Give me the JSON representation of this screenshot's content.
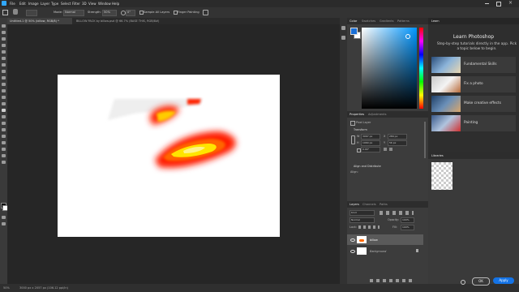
{
  "menu": [
    "File",
    "Edit",
    "Image",
    "Layer",
    "Type",
    "Select",
    "Filter",
    "3D",
    "View",
    "Window",
    "Help"
  ],
  "options": {
    "mode_label": "Mode:",
    "mode_value": "Normal",
    "strength_label": "Strength:",
    "strength_value": "50%",
    "angle_value": "0°",
    "sample_all": "Sample All Layers",
    "finger": "Finger Painting"
  },
  "tabs": [
    "Untitled-1 @ 50% (billow, RGB/8) *",
    "BILLOW PACK by billow.psd @ 66.7% (BASE THIS, RGB/8#)"
  ],
  "status": {
    "zoom": "50%",
    "doc": "3000 px x 2057 px (106.12 ppi/in)"
  },
  "color_panel": {
    "tabs": [
      "Color",
      "Swatches",
      "Gradients",
      "Patterns"
    ],
    "fg": "#1a6fd6",
    "bg": "#ffffff",
    "hue": "#0096ff"
  },
  "properties": {
    "tabs": [
      "Properties",
      "Adjustments"
    ],
    "layer_type": "Pixel Layer",
    "transform_title": "Transform",
    "w": "3067 px",
    "h": "1960 px",
    "x": "289 px",
    "y": "56 px",
    "angle": "0.00°",
    "align_title": "Align and Distribute",
    "align_label": "Align:"
  },
  "layers": {
    "tabs": [
      "Layers",
      "Channels",
      "Paths"
    ],
    "kind": "Kind",
    "blend": "Normal",
    "opacity_label": "Opacity:",
    "opacity_value": "100%",
    "lock_label": "Lock:",
    "fill_label": "Fill:",
    "fill_value": "100%",
    "items": [
      {
        "name": "billow",
        "selected": true
      },
      {
        "name": "Background",
        "selected": false
      }
    ]
  },
  "learn": {
    "tab": "Learn",
    "title": "Learn Photoshop",
    "subtitle": "Step-by-step tutorials directly in the app. Pick a topic below to begin.",
    "topics": [
      "Fundamental Skills",
      "Fix a photo",
      "Make creative effects",
      "Painting"
    ]
  },
  "libraries": {
    "tab": "Libraries",
    "ok": "OK",
    "apply": "Apply"
  }
}
